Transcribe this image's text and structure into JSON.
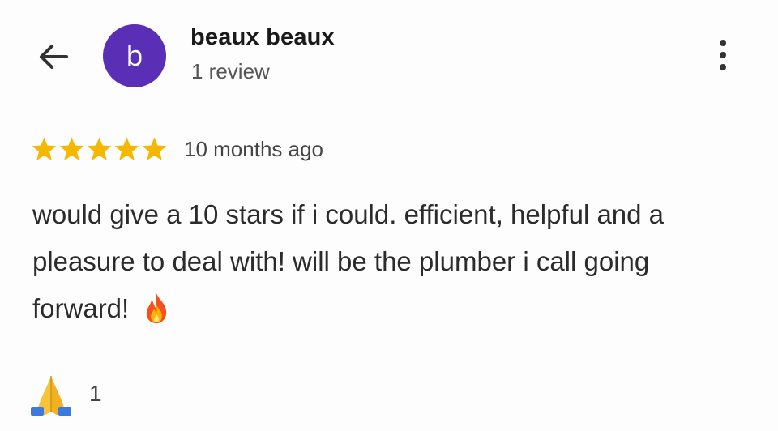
{
  "header": {
    "back_icon": "arrow-left-icon",
    "avatar_letter": "b",
    "avatar_color": "#5b2fb5",
    "reviewer_name": "beaux beaux",
    "review_count": "1 review",
    "more_icon": "more-vert-icon"
  },
  "review": {
    "rating": 5,
    "max_rating": 5,
    "star_color": "#f5b800",
    "date": "10 months ago",
    "text": "would give a 10 stars if i could. efficient, helpful and a pleasure to deal with! will be the plumber i call going forward!",
    "emoji": "fire-emoji"
  },
  "reactions": {
    "icon": "folded-hands-emoji",
    "count": "1"
  }
}
